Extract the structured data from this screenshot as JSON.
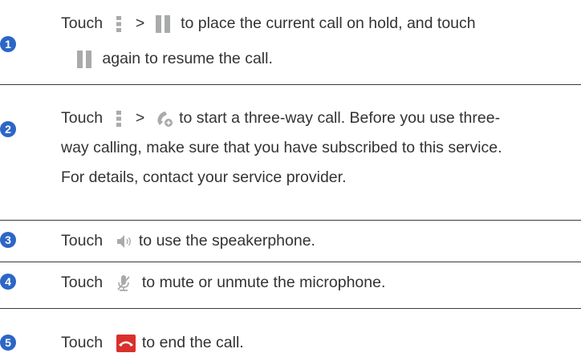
{
  "steps": [
    {
      "number": "1",
      "lines": [
        {
          "a": "Touch",
          "b": ">",
          "c": "to place the current call on hold, and touch"
        },
        {
          "c": "again to resume the call."
        }
      ]
    },
    {
      "number": "2",
      "lines": [
        {
          "a": "Touch",
          "b": ">",
          "c": "to start a three-way call. Before you use three-"
        },
        {
          "c": "way calling, make sure that you have subscribed to this service."
        },
        {
          "c": "For details, contact your service provider."
        }
      ]
    },
    {
      "number": "3",
      "lines": [
        {
          "a": "Touch",
          "c": "to use the speakerphone."
        }
      ]
    },
    {
      "number": "4",
      "lines": [
        {
          "a": "Touch",
          "c": "to mute or unmute the microphone."
        }
      ]
    },
    {
      "number": "5",
      "lines": [
        {
          "a": "Touch",
          "c": "to end the call."
        }
      ]
    }
  ],
  "colors": {
    "accent": "#2c66c6",
    "icon_gray": "#a9aaaa",
    "end_call_red": "#d9302c"
  },
  "icons": [
    "menu-dots-icon",
    "pause-icon",
    "add-call-icon",
    "speaker-icon",
    "mute-microphone-icon",
    "end-call-icon"
  ]
}
